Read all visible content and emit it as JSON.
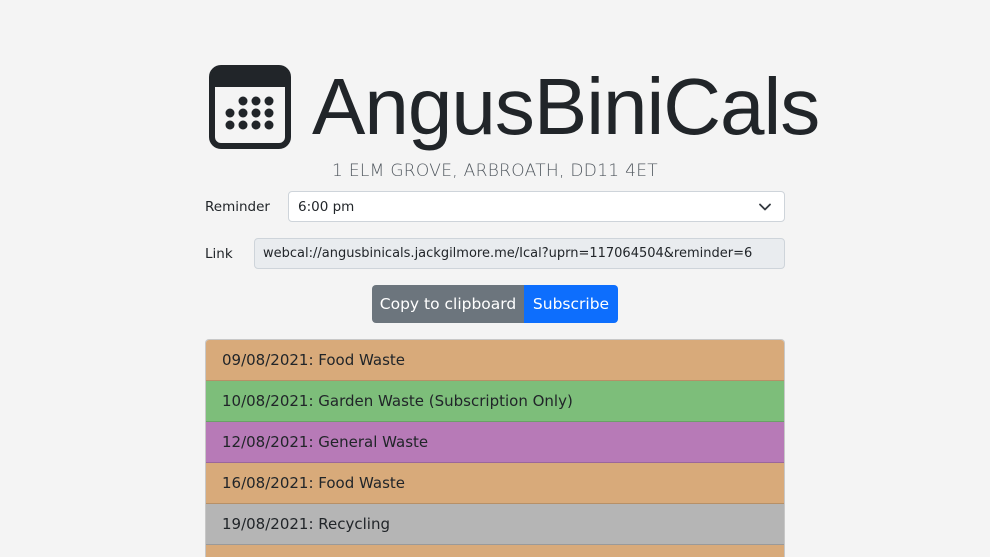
{
  "brand": {
    "title": "AngusBiniCals",
    "icon": "calendar-icon"
  },
  "address": "1 ELM GROVE, ARBROATH, DD11 4ET",
  "reminder": {
    "label": "Reminder",
    "selected": "6:00 pm"
  },
  "link": {
    "label": "Link",
    "value": "webcal://angusbinicals.jackgilmore.me/Ical?uprn=117064504&reminder=6"
  },
  "buttons": {
    "copy_label": "Copy to clipboard",
    "subscribe_label": "Subscribe"
  },
  "colors": {
    "food": "#d8aa7a",
    "garden": "#7dbe7a",
    "general": "#b77ab7",
    "recycling": "#b5b5b5",
    "copy_button": "#6c757d",
    "subscribe_button": "#0d6efd"
  },
  "collections": [
    {
      "text": "09/08/2021: Food Waste",
      "color": "#d8aa7a"
    },
    {
      "text": "10/08/2021: Garden Waste (Subscription Only)",
      "color": "#7dbe7a"
    },
    {
      "text": "12/08/2021: General Waste",
      "color": "#b77ab7"
    },
    {
      "text": "16/08/2021: Food Waste",
      "color": "#d8aa7a"
    },
    {
      "text": "19/08/2021: Recycling",
      "color": "#b5b5b5"
    },
    {
      "text": "",
      "color": "#d8aa7a"
    }
  ]
}
